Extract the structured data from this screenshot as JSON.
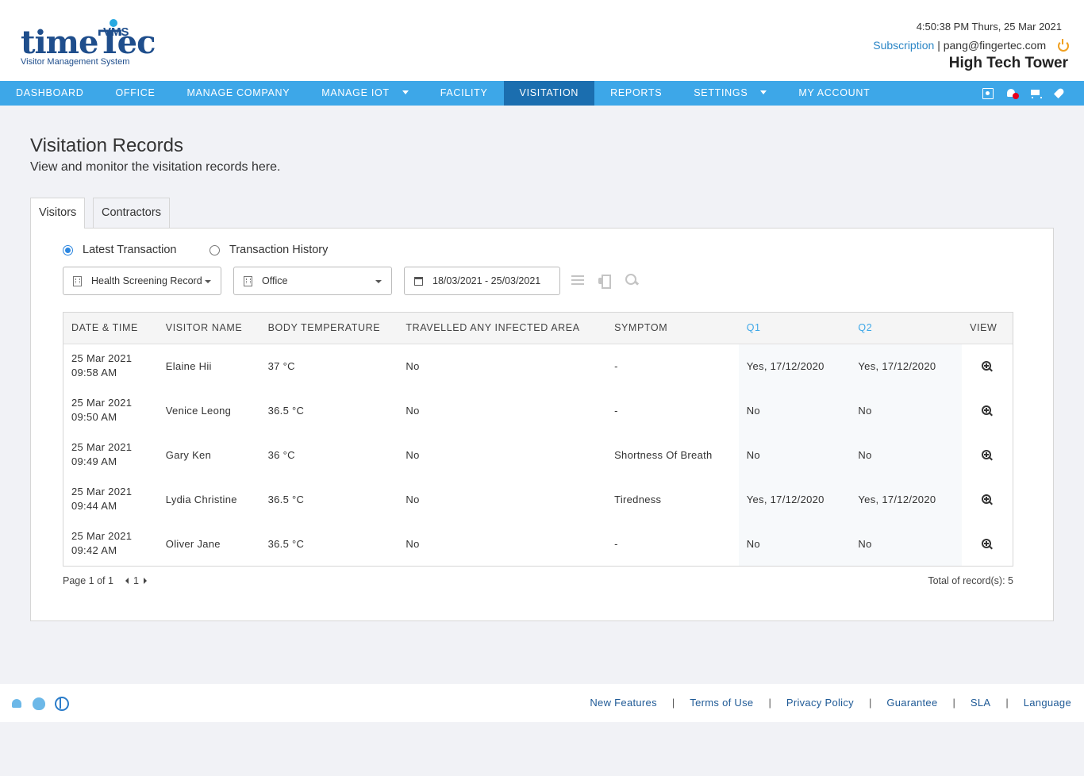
{
  "header": {
    "logo_word_main": "time",
    "logo_word_tec": "Tec",
    "logo_vms": "VMS",
    "logo_subtitle": "Visitor Management System",
    "datetime": "4:50:38 PM  Thurs, 25 Mar 2021",
    "subscription_label": "Subscription",
    "separator": "|",
    "user_email": "pang@fingertec.com",
    "building_name": "High Tech Tower"
  },
  "nav": {
    "dashboard": "DASHBOARD",
    "office": "OFFICE",
    "manage_company": "MANAGE COMPANY",
    "manage_iot": "MANAGE IOT",
    "facility": "FACILITY",
    "visitation": "VISITATION",
    "reports": "REPORTS",
    "settings": "SETTINGS",
    "my_account": "MY ACCOUNT"
  },
  "page": {
    "title": "Visitation Records",
    "description": "View and monitor the visitation records here."
  },
  "tabs": {
    "visitors": "Visitors",
    "contractors": "Contractors"
  },
  "radios": {
    "latest": "Latest Transaction",
    "history": "Transaction History",
    "selected": "latest"
  },
  "filters": {
    "record_type": "Health Screening Record",
    "location": "Office",
    "date_range": "18/03/2021 - 25/03/2021"
  },
  "table": {
    "headers": {
      "datetime": "DATE & TIME",
      "visitor_name": "VISITOR NAME",
      "body_temperature": "BODY TEMPERATURE",
      "travelled": "TRAVELLED ANY INFECTED AREA",
      "symptom": "SYMPTOM",
      "q1": "Q1",
      "q2": "Q2",
      "view": "VIEW"
    },
    "rows": [
      {
        "date": "25 Mar 2021",
        "time": "09:58 AM",
        "name": "Elaine Hii",
        "temp": "37 °C",
        "travelled": "No",
        "symptom": "-",
        "q1": "Yes, 17/12/2020",
        "q2": "Yes, 17/12/2020"
      },
      {
        "date": "25 Mar 2021",
        "time": "09:50 AM",
        "name": "Venice Leong",
        "temp": "36.5 °C",
        "travelled": "No",
        "symptom": "-",
        "q1": "No",
        "q2": "No"
      },
      {
        "date": "25 Mar 2021",
        "time": "09:49 AM",
        "name": "Gary Ken",
        "temp": "36 °C",
        "travelled": "No",
        "symptom": "Shortness Of Breath",
        "q1": "No",
        "q2": "No"
      },
      {
        "date": "25 Mar 2021",
        "time": "09:44 AM",
        "name": "Lydia Christine",
        "temp": "36.5 °C",
        "travelled": "No",
        "symptom": "Tiredness",
        "q1": "Yes, 17/12/2020",
        "q2": "Yes, 17/12/2020"
      },
      {
        "date": "25 Mar 2021",
        "time": "09:42 AM",
        "name": "Oliver Jane",
        "temp": "36.5 °C",
        "travelled": "No",
        "symptom": "-",
        "q1": "No",
        "q2": "No"
      }
    ]
  },
  "pagination": {
    "page_info": "Page 1 of 1",
    "current_page": "1",
    "total": "Total of record(s): 5"
  },
  "footer": {
    "links": [
      "New Features",
      "Terms of Use",
      "Privacy Policy",
      "Guarantee",
      "SLA",
      "Language"
    ],
    "separator": "|"
  },
  "colors": {
    "nav_bg": "#3da7e8",
    "nav_active": "#1b6eaf",
    "brand": "#1f4e8c",
    "link": "#2b86c6"
  },
  "icons": {
    "nav_right": [
      "contact-icon",
      "notification-bell-icon",
      "cart-icon",
      "rocket-icon"
    ],
    "toolbar": [
      "list-icon",
      "print-icon",
      "search-icon"
    ],
    "footer": [
      "android-icon",
      "apple-icon",
      "globe-icon"
    ]
  }
}
